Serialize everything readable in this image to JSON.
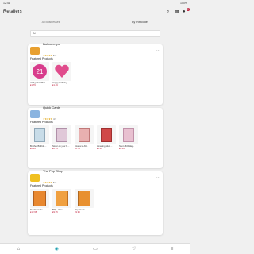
{
  "status": {
    "time": "12:41",
    "battery": "100%"
  },
  "header": {
    "title": "Retailers"
  },
  "tabs": [
    {
      "label": "All Businesses"
    },
    {
      "label": "By Postcode"
    }
  ],
  "filter": {
    "value": "N"
  },
  "retailers": [
    {
      "name": "Balloonerys",
      "rating": "5.0",
      "stars": "★★★★★",
      "featured_label": "Featured Products",
      "products": [
        {
          "name": "21 Age Foil Ball...",
          "price": "£1.79"
        },
        {
          "name": "Happy Birthday...",
          "price": "£1.89"
        }
      ]
    },
    {
      "name": "Quick Cards",
      "rating": "4.9",
      "stars": "★★★★★",
      "featured_label": "Featured Products",
      "products": [
        {
          "name": "Brother Birthda...",
          "price": "£0.49"
        },
        {
          "name": "Sister on your B...",
          "price": "£0.79"
        },
        {
          "name": "Kisses to All...",
          "price": "£0.79"
        },
        {
          "name": "Amazing Mum...",
          "price": "£0.49"
        },
        {
          "name": "She's Birthday...",
          "price": "£0.49"
        }
      ]
    },
    {
      "name": "The Pop Shop",
      "rating": "5.0",
      "stars": "★★★★★",
      "featured_label": "Featured Products",
      "products": [
        {
          "name": "Dumbo Cake...",
          "price": "£12.95"
        },
        {
          "name": "Billy - Saw",
          "price": "£9.95"
        },
        {
          "name": "Pop! Hook",
          "price": "£9.95"
        }
      ]
    }
  ]
}
